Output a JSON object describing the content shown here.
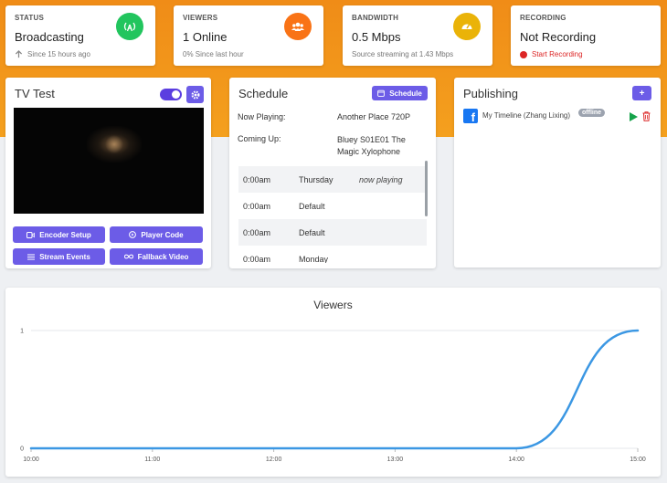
{
  "stats": [
    {
      "label": "STATUS",
      "value": "Broadcasting",
      "sub": "Since 15 hours ago",
      "icon": "broadcast-icon",
      "color": "#22c55e"
    },
    {
      "label": "VIEWERS",
      "value": "1 Online",
      "sub": "0% Since last hour",
      "icon": "users-icon",
      "color": "#f97316"
    },
    {
      "label": "BANDWIDTH",
      "value": "0.5 Mbps",
      "sub": "Source streaming at 1.43 Mbps",
      "icon": "gauge-icon",
      "color": "#eab308"
    },
    {
      "label": "RECORDING",
      "value": "Not Recording",
      "sub": "Start Recording"
    }
  ],
  "stream": {
    "title": "TV Test",
    "buttons": {
      "encoder": "Encoder Setup",
      "player": "Player Code",
      "events": "Stream Events",
      "fallback": "Fallback Video"
    }
  },
  "schedule": {
    "title": "Schedule",
    "button": "Schedule",
    "now_playing_label": "Now Playing:",
    "now_playing_value": "Another Place 720P",
    "coming_up_label": "Coming Up:",
    "coming_up_value": "Bluey S01E01 The Magic Xylophone",
    "items": [
      {
        "time": "0:00am",
        "day": "Thursday",
        "note": "now playing"
      },
      {
        "time": "0:00am",
        "day": "Default",
        "note": ""
      },
      {
        "time": "0:00am",
        "day": "Default",
        "note": ""
      },
      {
        "time": "0:00am",
        "day": "Monday",
        "note": ""
      }
    ]
  },
  "publishing": {
    "title": "Publishing",
    "add_label": "+",
    "destination": "My Timeline (Zhang Lixing)",
    "status": "offline"
  },
  "chart_data": {
    "type": "line",
    "title": "Viewers",
    "x": [
      "10:00",
      "11:00",
      "12:00",
      "13:00",
      "14:00",
      "15:00"
    ],
    "series": [
      {
        "values": [
          0,
          0,
          0,
          0,
          0,
          1
        ]
      }
    ],
    "ylim": [
      0,
      1
    ],
    "yticks": [
      "0",
      "1"
    ],
    "color": "#3b97e3"
  }
}
